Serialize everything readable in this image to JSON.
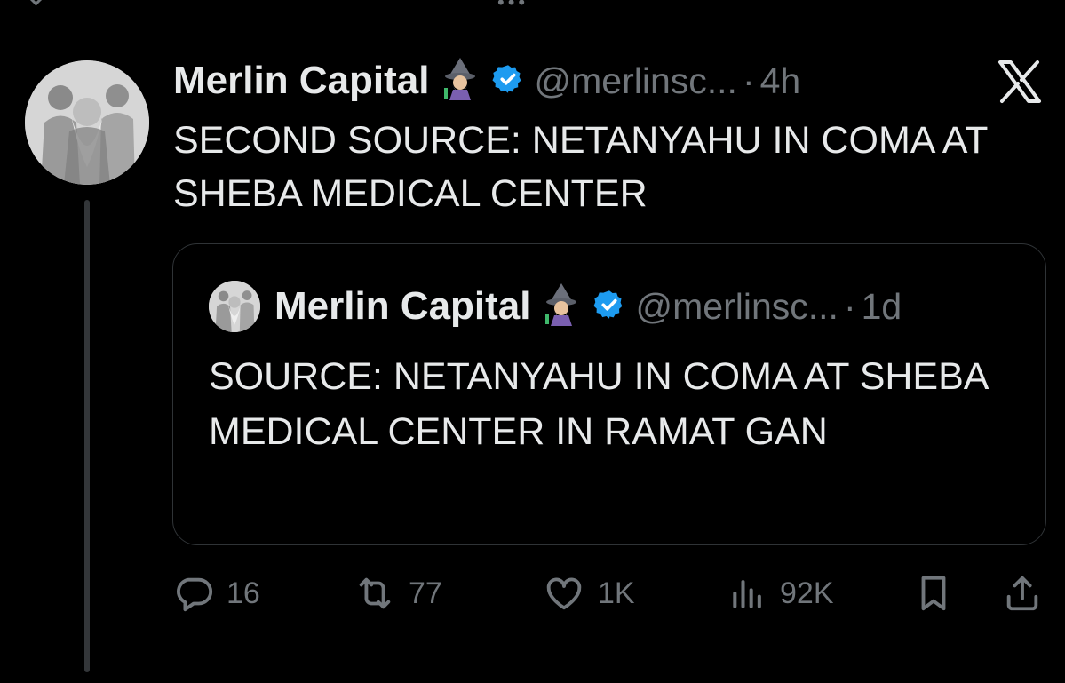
{
  "tweet": {
    "author_name": "Merlin Capital",
    "author_emoji": "🧙",
    "handle": "@merlinsc...",
    "separator": "·",
    "time": "4h",
    "text": "SECOND SOURCE: NETANYAHU IN COMA AT SHEBA MEDICAL CENTER"
  },
  "quoted": {
    "author_name": "Merlin Capital",
    "author_emoji": "🧙",
    "handle": "@merlinsc...",
    "separator": "·",
    "time": "1d",
    "text": "SOURCE: NETANYAHU IN COMA AT SHEBA MEDICAL CENTER IN RAMAT GAN"
  },
  "actions": {
    "replies": "16",
    "reposts": "77",
    "likes": "1K",
    "views": "92K"
  },
  "icons": {
    "top_right": "x-logo-icon",
    "verified": "verified-badge-icon",
    "reply": "reply-icon",
    "repost": "repost-icon",
    "like": "heart-icon",
    "views": "views-icon",
    "bookmark": "bookmark-icon",
    "share": "share-icon"
  },
  "colors": {
    "background": "#000000",
    "text": "#e7e9ea",
    "muted": "#71767b",
    "verified": "#1d9bf0",
    "border": "#2f3336"
  }
}
